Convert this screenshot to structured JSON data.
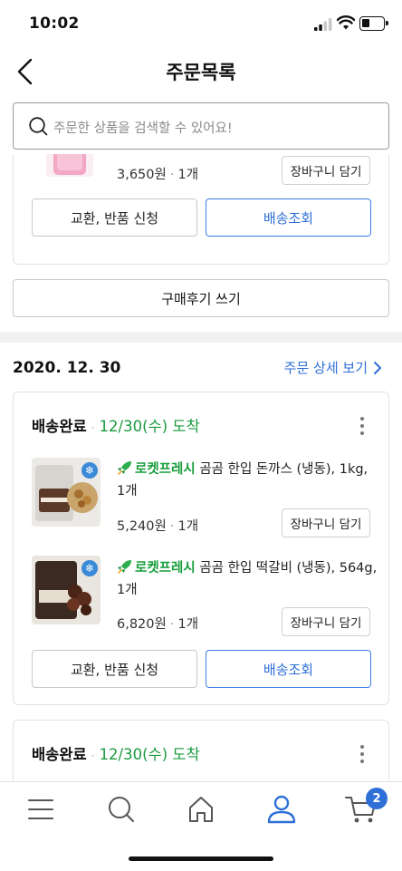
{
  "status_bar": {
    "time": "10:02",
    "battery_level": 0.3
  },
  "header": {
    "title": "주문목록"
  },
  "search": {
    "placeholder": "주문한 상품을 검색할 수 있어요!"
  },
  "prev_order": {
    "item_price": "3,650원",
    "item_qty": "1개",
    "add_to_cart_label": "장바구니 담기",
    "exchange_label": "교환, 반품 신청",
    "tracking_label": "배송조회",
    "review_label": "구매후기 쓰기"
  },
  "order": {
    "date": "2020. 12. 30",
    "detail_label": "주문 상세 보기",
    "shipment": {
      "status": "배송완료",
      "arrival": "12/30(수) 도착",
      "items": [
        {
          "badge": "로켓프레시",
          "name": "곰곰 한입 돈까스 (냉동), 1kg, 1개",
          "price": "5,240원",
          "qty": "1개",
          "add_to_cart_label": "장바구니 담기"
        },
        {
          "badge": "로켓프레시",
          "name": "곰곰 한입 떡갈비 (냉동), 564g, 1개",
          "price": "6,820원",
          "qty": "1개",
          "add_to_cart_label": "장바구니 담기"
        }
      ],
      "exchange_label": "교환, 반품 신청",
      "tracking_label": "배송조회"
    },
    "next_shipment": {
      "status": "배송완료",
      "arrival": "12/30(수) 도착"
    }
  },
  "bottom_nav": {
    "items": [
      "menu-icon",
      "search-icon",
      "home-icon",
      "profile-icon",
      "cart-icon"
    ],
    "active": "profile-icon",
    "cart_count": "2"
  },
  "colors": {
    "accent": "#2f6fd8",
    "fresh_green": "#169e3a",
    "arrival_green": "#1a9a3e"
  }
}
